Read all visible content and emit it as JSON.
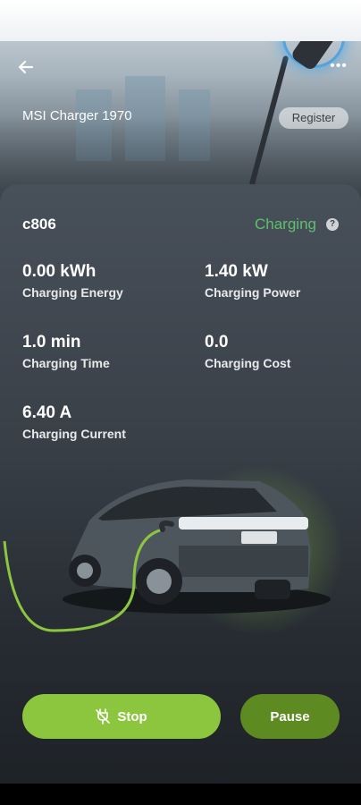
{
  "header": {
    "charger_name": "MSI Charger 1970",
    "register_label": "Register",
    "more_label": "•••"
  },
  "session": {
    "id": "c806",
    "status": "Charging",
    "status_color": "#5fbf6f",
    "help_label": "?"
  },
  "metrics": [
    {
      "value": "0.00 kWh",
      "label": "Charging Energy"
    },
    {
      "value": "1.40 kW",
      "label": "Charging Power"
    },
    {
      "value": "1.0 min",
      "label": "Charging Time"
    },
    {
      "value": "0.0",
      "label": "Charging Cost"
    },
    {
      "value": "6.40 A",
      "label": "Charging Current"
    }
  ],
  "actions": {
    "stop_label": "Stop",
    "pause_label": "Pause",
    "stop_color": "#8cc63f",
    "pause_color": "#5e8a22"
  },
  "icons": {
    "back": "arrow-left-icon",
    "more": "more-dots-icon",
    "help": "help-circle-icon",
    "stop": "plug-off-icon"
  }
}
